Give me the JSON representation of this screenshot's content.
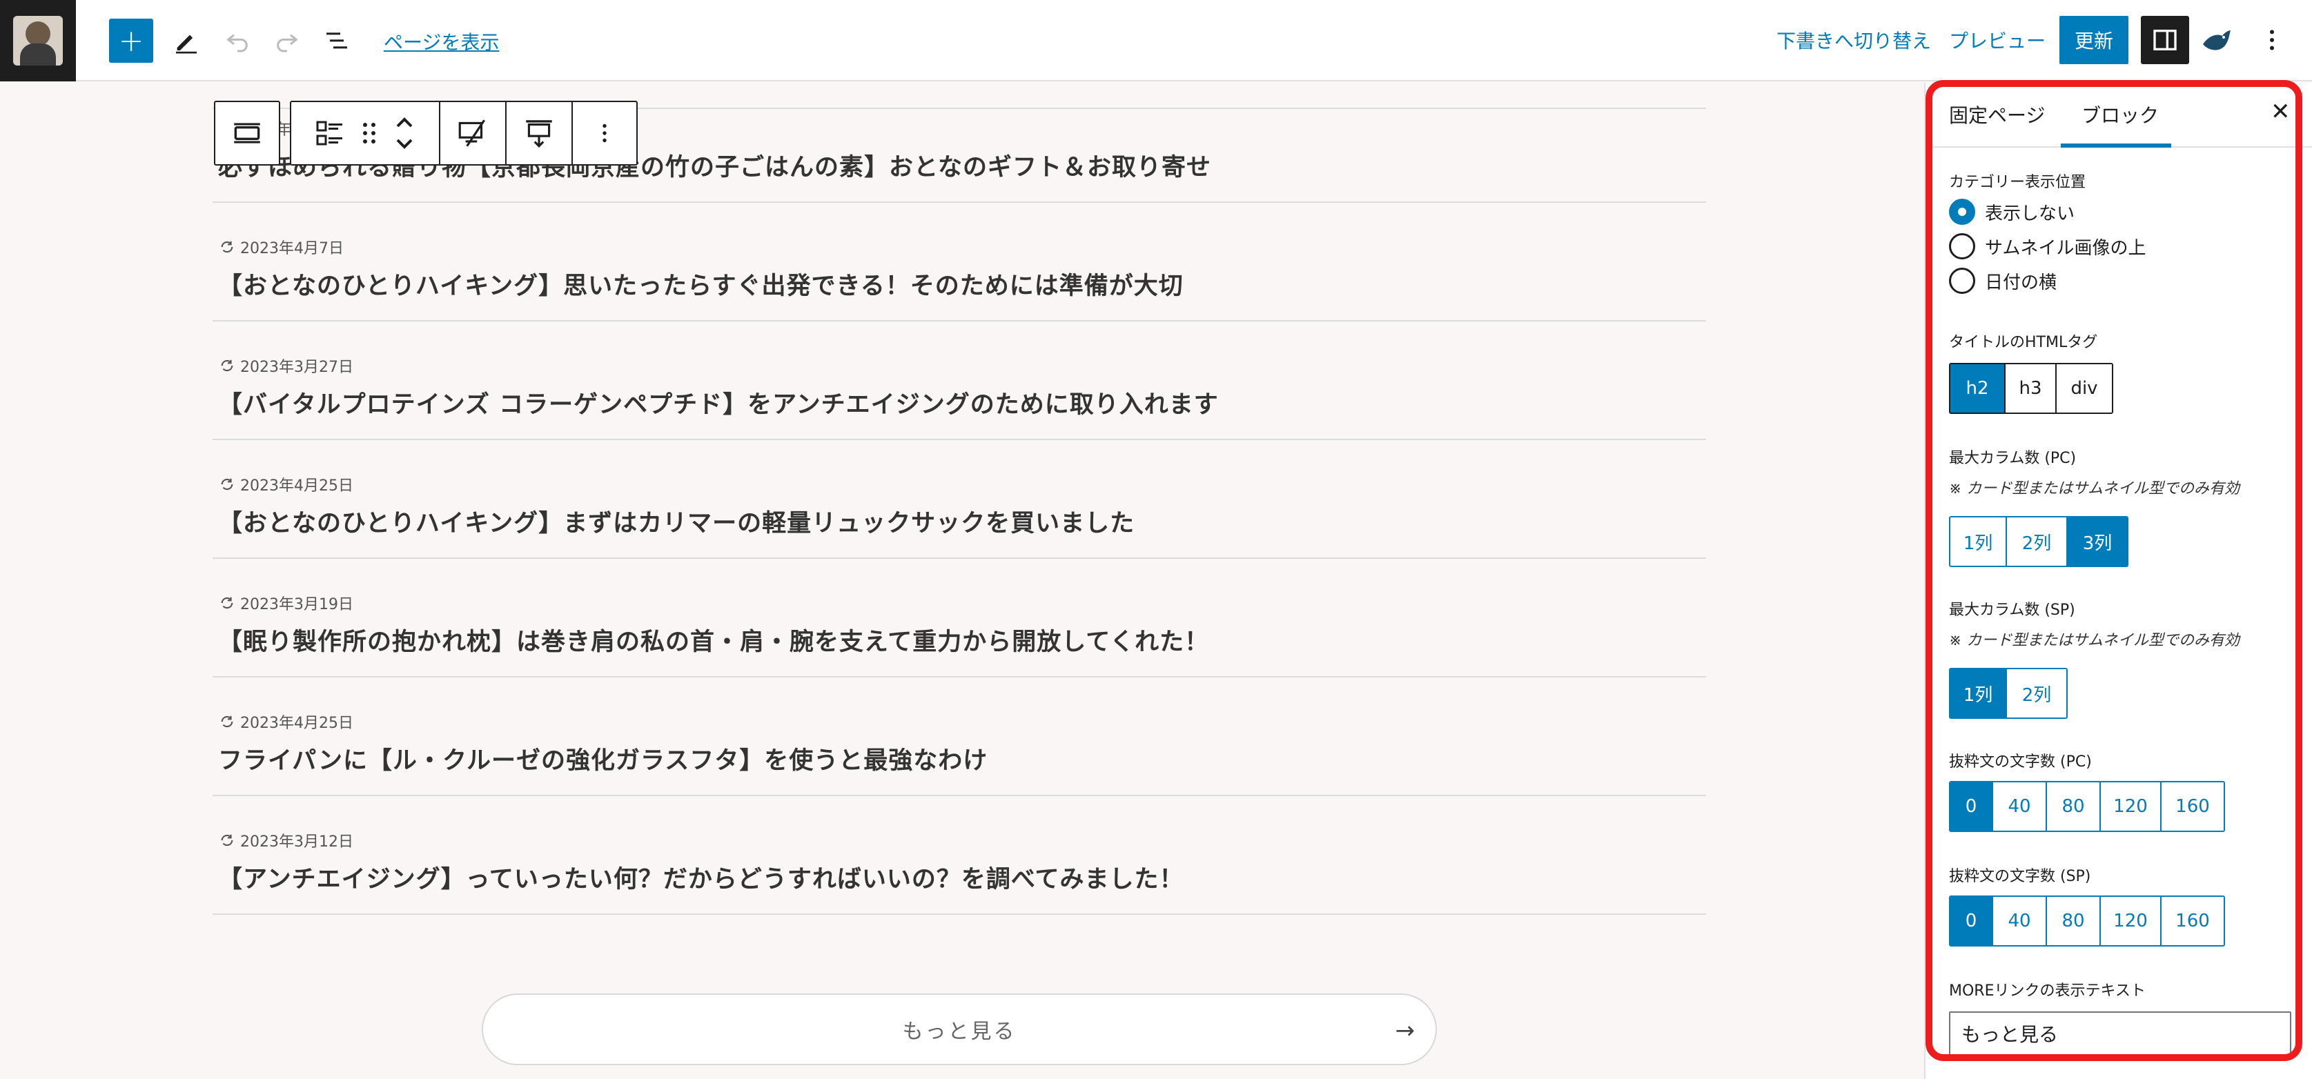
{
  "header": {
    "view_page": "ページを表示",
    "switch_to_draft": "下書きへ切り替え",
    "preview": "プレビュー",
    "update": "更新"
  },
  "posts": [
    {
      "date": "",
      "title": "必ずほめられる贈り物【京都長岡京産の竹の子ごはんの素】おとなのギフト＆お取り寄せ"
    },
    {
      "date": "2023年4月7日",
      "title": "【おとなのひとりハイキング】思いたったらすぐ出発できる！そのためには準備が大切"
    },
    {
      "date": "2023年3月27日",
      "title": "【バイタルプロテインズ コラーゲンペプチド】をアンチエイジングのために取り入れます"
    },
    {
      "date": "2023年4月25日",
      "title": "【おとなのひとりハイキング】まずはカリマーの軽量リュックサックを買いました"
    },
    {
      "date": "2023年3月19日",
      "title": "【眠り製作所の抱かれ枕】は巻き肩の私の首・肩・腕を支えて重力から開放してくれた！"
    },
    {
      "date": "2023年4月25日",
      "title": "フライパンに【ル・クルーゼの強化ガラスフタ】を使うと最強なわけ"
    },
    {
      "date": "2023年3月12日",
      "title": "【アンチエイジング】っていったい何？だからどうすればいいの？を調べてみました！"
    }
  ],
  "first_post_date_partial": "年",
  "more_button": {
    "label": "もっと見る",
    "arrow": "→"
  },
  "sidebar": {
    "tab_page": "固定ページ",
    "tab_block": "ブロック",
    "close": "✕",
    "category_position": {
      "label": "カテゴリー表示位置",
      "options": [
        "表示しない",
        "サムネイル画像の上",
        "日付の横"
      ],
      "selected": 0
    },
    "title_tag": {
      "label": "タイトルのHTMLタグ",
      "options": [
        "h2",
        "h3",
        "div"
      ],
      "selected": 0
    },
    "max_columns_pc": {
      "label": "最大カラム数 (PC)",
      "note": "※ カード型またはサムネイル型でのみ有効",
      "options": [
        "1列",
        "2列",
        "3列"
      ],
      "selected": 2
    },
    "max_columns_sp": {
      "label": "最大カラム数 (SP)",
      "note": "※ カード型またはサムネイル型でのみ有効",
      "options": [
        "1列",
        "2列"
      ],
      "selected": 0
    },
    "excerpt_pc": {
      "label": "抜粋文の文字数 (PC)",
      "options": [
        "0",
        "40",
        "80",
        "120",
        "160"
      ],
      "selected": 0
    },
    "excerpt_sp": {
      "label": "抜粋文の文字数 (SP)",
      "options": [
        "0",
        "40",
        "80",
        "120",
        "160"
      ],
      "selected": 0
    },
    "more_link_text": {
      "label": "MOREリンクの表示テキスト",
      "value": "もっと見る"
    }
  },
  "colors": {
    "accent": "#007cba",
    "highlight": "#ee1c1c",
    "dark": "#1e1e1e"
  }
}
